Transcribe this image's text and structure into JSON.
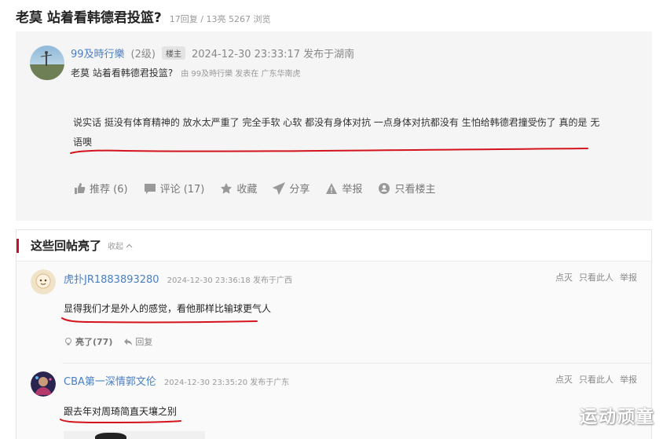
{
  "post": {
    "title": "老莫 站着看韩德君投篮?",
    "stats": "17回复 / 13亮 5267 浏览"
  },
  "op": {
    "author": "99及時行樂",
    "level": "(2级)",
    "badge": "楼主",
    "time": "2024-12-30 23:33:17 发布于湖南",
    "subtitle": "老莫 站着看韩德君投篮?",
    "from": "由 99及時行樂 发表在 广东华南虎",
    "body": "说实话 挺没有体育精神的 放水太严重了 完全手软 心软 都没有身体对抗 一点身体对抗都没有 生怕给韩德君撞受伤了 真的是 无语噢",
    "actions": [
      {
        "label": "推荐 (6)",
        "icon": "thumbs-up-icon"
      },
      {
        "label": "评论 (17)",
        "icon": "comment-icon"
      },
      {
        "label": "收藏",
        "icon": "star-icon"
      },
      {
        "label": "分享",
        "icon": "share-icon"
      },
      {
        "label": "举报",
        "icon": "warning-icon"
      },
      {
        "label": "只看楼主",
        "icon": "user-filter-icon"
      }
    ]
  },
  "hot_replies": {
    "title": "这些回帖亮了",
    "collapse": "收起",
    "ops": [
      "点灭",
      "只看此人",
      "举报"
    ],
    "items": [
      {
        "name": "虎扑JR1883893280",
        "time": "2024-12-30 23:36:18 发布于广西",
        "body": "显得我们才是外人的感觉，看他那样比输球更气人",
        "light": "亮了(77)",
        "reply": "回复"
      },
      {
        "name": "CBA第一深情郭文伦",
        "time": "2024-12-30 23:35:20 发布于广东",
        "body": "跟去年对周琦简直天壤之别"
      }
    ]
  },
  "watermark": "运动顽童",
  "colors": {
    "link": "#4a7fc1",
    "accent_red": "#c8102e",
    "underline_red": "#d4141c"
  }
}
